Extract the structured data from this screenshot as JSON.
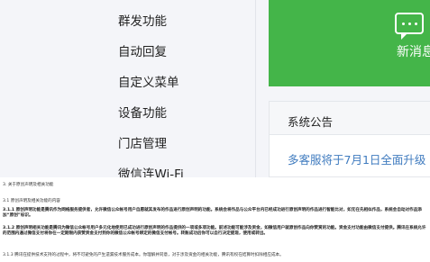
{
  "sidebar": {
    "items": [
      {
        "label": "群发功能"
      },
      {
        "label": "自动回复"
      },
      {
        "label": "自定义菜单"
      },
      {
        "label": "设备功能"
      },
      {
        "label": "门店管理"
      },
      {
        "label": "微信连Wi-Fi"
      }
    ]
  },
  "message_card": {
    "label": "新消息",
    "color": "#44b549",
    "icon": "chat-bubble-icon"
  },
  "notice": {
    "title": "系统公告",
    "link": "多客服将于7月1日全面升级"
  },
  "document": {
    "lines": [
      "3. 关于原创声明及相关功能",
      "3.1 原创声明及相关功能的内容",
      "3.1.1 原创声明功能是腾讯作为网络服务提供者，允许微信公众帐号用户自愿就其发布的作品进行原创声明的功能。系统会将作品与公众平台内已经成功进行原创声明的作品进行智能比对，如无在先相似作品，系统会自动对作品添加“原创”标识。",
      "3.1.2 原创声明相关功能是腾讯为微信公众帐号用户多元化地使用已成功进行原创声明的作品提供的一项或多项功能。前述功能可能涉及资金，如微信用户就原创作品向你赞赏的功能。资金支付功能由微信支付提供。腾讯在系统允许的范围内通过微信支付将你在一定期限内获赞资金支付到你的微信公众帐号绑定的微信支付帐号。转账成功后你可以自行决定提现，使用或转出。",
      "3.1.3 腾讯在提供技术支持的过程中，将不可避免的产生遗漏技术服务成本。你理解并同意，对于涉及资金的相关功能，腾讯有权在结算时扣除相应成本。"
    ]
  }
}
